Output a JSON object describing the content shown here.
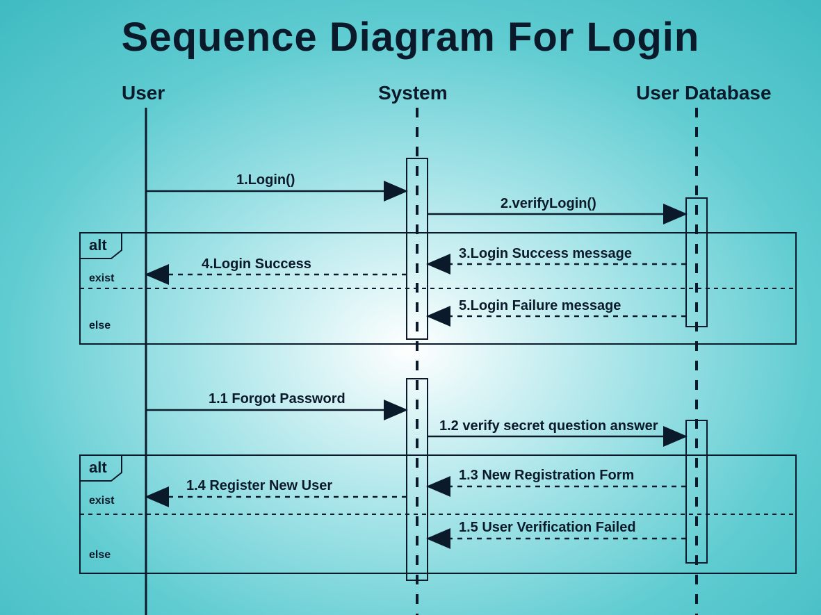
{
  "title": "Sequence Diagram For Login",
  "participants": {
    "user": "User",
    "system": "System",
    "db": "User Database"
  },
  "messages": {
    "m1": "1.Login()",
    "m2": "2.verifyLogin()",
    "m3": "3.Login Success message",
    "m4": "4.Login Success",
    "m5": "5.Login Failure message",
    "m11": "1.1 Forgot Password",
    "m12": "1.2 verify secret question answer",
    "m13": "1.3 New Registration Form",
    "m14": "1.4 Register New User",
    "m15": "1.5 User Verification Failed"
  },
  "fragments": {
    "alt1": {
      "label": "alt",
      "guard_a": "exist",
      "guard_b": "else"
    },
    "alt2": {
      "label": "alt",
      "guard_a": "exist",
      "guard_b": "else"
    }
  },
  "chart_data": {
    "type": "sequence-diagram",
    "title": "Sequence Diagram For Login",
    "participants": [
      "User",
      "System",
      "User Database"
    ],
    "interactions": [
      {
        "n": "1",
        "from": "User",
        "to": "System",
        "label": "Login()",
        "kind": "sync"
      },
      {
        "n": "2",
        "from": "System",
        "to": "User Database",
        "label": "verifyLogin()",
        "kind": "sync"
      },
      {
        "fragment": "alt",
        "guards": [
          "exist",
          "else"
        ],
        "branches": [
          [
            {
              "n": "3",
              "from": "User Database",
              "to": "System",
              "label": "Login Success message",
              "kind": "return"
            },
            {
              "n": "4",
              "from": "System",
              "to": "User",
              "label": "Login Success",
              "kind": "return"
            }
          ],
          [
            {
              "n": "5",
              "from": "User Database",
              "to": "System",
              "label": "Login Failure message",
              "kind": "return"
            }
          ]
        ]
      },
      {
        "n": "1.1",
        "from": "User",
        "to": "System",
        "label": "Forgot Password",
        "kind": "sync"
      },
      {
        "n": "1.2",
        "from": "System",
        "to": "User Database",
        "label": "verify secret question answer",
        "kind": "sync"
      },
      {
        "fragment": "alt",
        "guards": [
          "exist",
          "else"
        ],
        "branches": [
          [
            {
              "n": "1.3",
              "from": "User Database",
              "to": "System",
              "label": "New Registration Form",
              "kind": "return"
            },
            {
              "n": "1.4",
              "from": "System",
              "to": "User",
              "label": "Register New User",
              "kind": "return"
            }
          ],
          [
            {
              "n": "1.5",
              "from": "User Database",
              "to": "System",
              "label": "User Verification Failed",
              "kind": "return"
            }
          ]
        ]
      }
    ]
  }
}
